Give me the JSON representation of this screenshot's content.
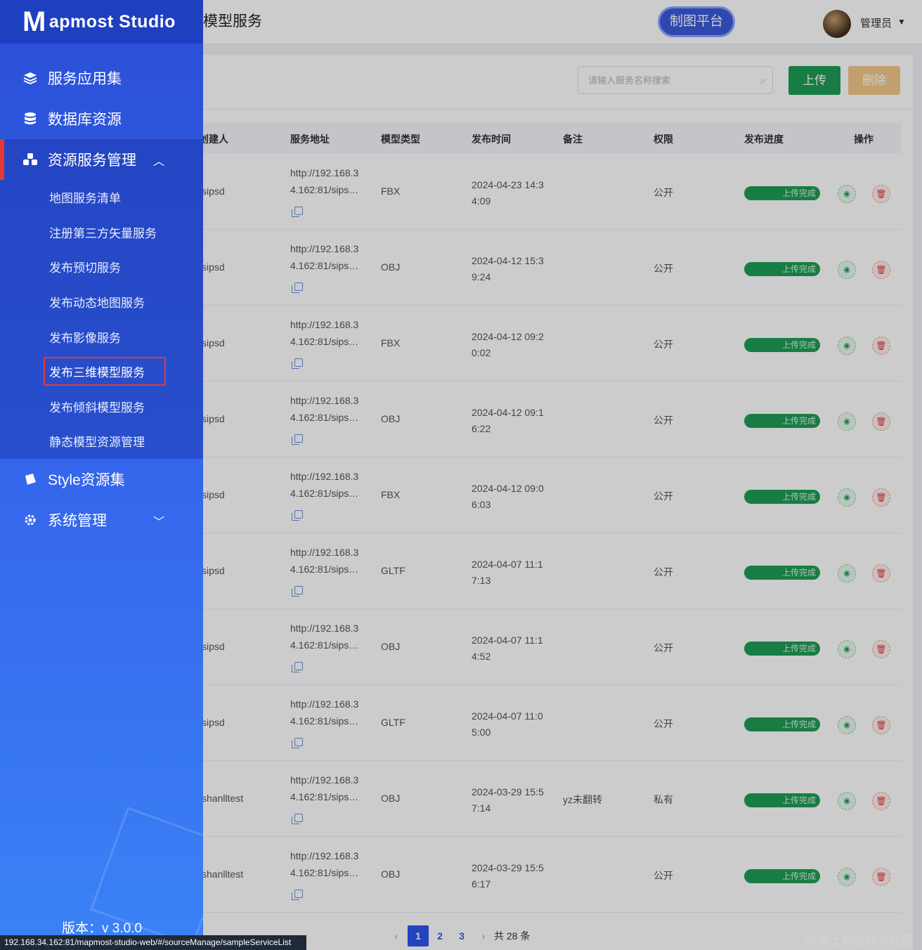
{
  "sidebar": {
    "logo_mark": "M",
    "logo_text": "apmost Studio",
    "menu": [
      {
        "label": "服务应用集",
        "icon": "layers-icon"
      },
      {
        "label": "数据库资源",
        "icon": "database-icon"
      },
      {
        "label": "资源服务管理",
        "icon": "cubes-icon",
        "expanded": true
      },
      {
        "label": "Style资源集",
        "icon": "style-icon"
      },
      {
        "label": "系统管理",
        "icon": "gear-icon"
      }
    ],
    "submenu": [
      "地图服务清单",
      "注册第三方矢量服务",
      "发布预切服务",
      "发布动态地图服务",
      "发布影像服务",
      "发布三维模型服务",
      "发布倾斜模型服务",
      "静态模型资源管理"
    ],
    "selected_sub": "发布三维模型服务",
    "version": "版本：v 3.0.0"
  },
  "header": {
    "page_title": "模型服务",
    "platform_button": "制图平台",
    "user": "管理员"
  },
  "toolbar": {
    "search_placeholder": "请输入服务名称搜索",
    "upload_label": "上传",
    "delete_label": "删除"
  },
  "table": {
    "columns": [
      "创建人",
      "服务地址",
      "模型类型",
      "发布时间",
      "备注",
      "权限",
      "发布进度",
      "操作"
    ],
    "rows": [
      {
        "creator": "sipsd",
        "url1": "http://192.168.3",
        "url2": "4.162:81/sips…",
        "type": "FBX",
        "time1": "2024-04-23 14:3",
        "time2": "4:09",
        "note": "",
        "perm": "公开",
        "progress": "上传完成",
        "progress_value": 100
      },
      {
        "creator": "sipsd",
        "url1": "http://192.168.3",
        "url2": "4.162:81/sips…",
        "type": "OBJ",
        "time1": "2024-04-12 15:3",
        "time2": "9:24",
        "note": "",
        "perm": "公开",
        "progress": "上传完成",
        "progress_value": 100
      },
      {
        "creator": "sipsd",
        "url1": "http://192.168.3",
        "url2": "4.162:81/sips…",
        "type": "FBX",
        "time1": "2024-04-12 09:2",
        "time2": "0:02",
        "note": "",
        "perm": "公开",
        "progress": "上传完成",
        "progress_value": 100
      },
      {
        "creator": "sipsd",
        "url1": "http://192.168.3",
        "url2": "4.162:81/sips…",
        "type": "OBJ",
        "time1": "2024-04-12 09:1",
        "time2": "6:22",
        "note": "",
        "perm": "公开",
        "progress": "上传完成",
        "progress_value": 100
      },
      {
        "creator": "sipsd",
        "url1": "http://192.168.3",
        "url2": "4.162:81/sips…",
        "type": "FBX",
        "time1": "2024-04-12 09:0",
        "time2": "6:03",
        "note": "",
        "perm": "公开",
        "progress": "上传完成",
        "progress_value": 100
      },
      {
        "creator": "sipsd",
        "url1": "http://192.168.3",
        "url2": "4.162:81/sips…",
        "type": "GLTF",
        "time1": "2024-04-07 11:1",
        "time2": "7:13",
        "note": "",
        "perm": "公开",
        "progress": "上传完成",
        "progress_value": 100
      },
      {
        "creator": "sipsd",
        "url1": "http://192.168.3",
        "url2": "4.162:81/sips…",
        "type": "OBJ",
        "time1": "2024-04-07 11:1",
        "time2": "4:52",
        "note": "",
        "perm": "公开",
        "progress": "上传完成",
        "progress_value": 100
      },
      {
        "creator": "sipsd",
        "url1": "http://192.168.3",
        "url2": "4.162:81/sips…",
        "type": "GLTF",
        "time1": "2024-04-07 11:0",
        "time2": "5:00",
        "note": "",
        "perm": "公开",
        "progress": "上传完成",
        "progress_value": 100
      },
      {
        "creator": "shanlltest",
        "url1": "http://192.168.3",
        "url2": "4.162:81/sips…",
        "type": "OBJ",
        "time1": "2024-03-29 15:5",
        "time2": "7:14",
        "note": "yz未翻转",
        "perm": "私有",
        "progress": "上传完成",
        "progress_value": 100
      },
      {
        "creator": "shanlltest",
        "url1": "http://192.168.3",
        "url2": "4.162:81/sips…",
        "type": "OBJ",
        "time1": "2024-03-29 15:5",
        "time2": "6:17",
        "note": "",
        "perm": "公开",
        "progress": "上传完成",
        "progress_value": 100
      }
    ]
  },
  "pagination": {
    "prev": "‹",
    "pages": [
      "1",
      "2",
      "3"
    ],
    "current": "1",
    "next": "›",
    "total": "共 28 条"
  },
  "status_url": "192.168.34.162:81/mapmost-studio-web/#/sourceManage/sampleServiceList",
  "corner_watermark": "@稀土掘金技术社区",
  "colors": {
    "sidebar_dark": "#1e3fc0",
    "sidebar_light": "#3b82f6",
    "upload_green": "#1f9d55",
    "delete_orange": "#f3c98a",
    "highlight_red": "#e53935"
  }
}
